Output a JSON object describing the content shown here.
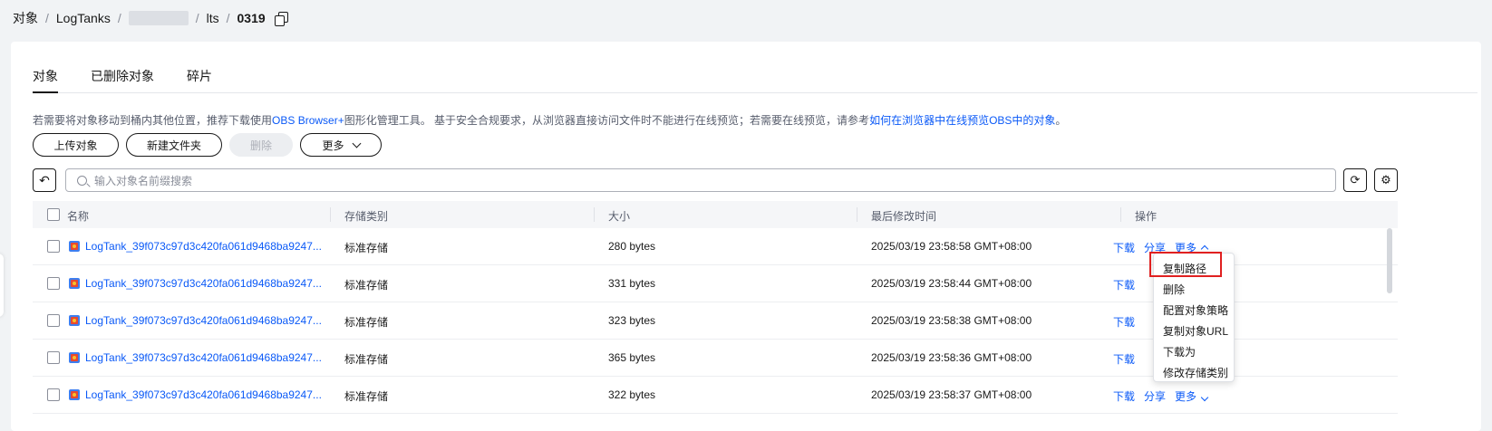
{
  "breadcrumb": {
    "root": "对象",
    "logtanks": "LogTanks",
    "lts": "lts",
    "current": "0319"
  },
  "tabs": [
    "对象",
    "已删除对象",
    "碎片"
  ],
  "info": {
    "prefix": "若需要将对象移动到桶内其他位置，推荐下载使用",
    "link1": "OBS Browser+",
    "middle": "图形化管理工具。 基于安全合规要求，从浏览器直接访问文件时不能进行在线预览；若需要在线预览，请参考",
    "link2": "如何在浏览器中在线预览OBS中的对象",
    "suffix": "。"
  },
  "toolbar": {
    "upload": "上传对象",
    "new_folder": "新建文件夹",
    "delete": "删除",
    "more": "更多"
  },
  "search": {
    "placeholder": "输入对象名前缀搜索"
  },
  "table": {
    "headers": {
      "name": "名称",
      "storage": "存储类别",
      "size": "大小",
      "modified": "最后修改时间",
      "actions": "操作"
    },
    "rows": [
      {
        "name": "LogTank_39f073c97d3c420fa061d9468ba9247...",
        "storage": "标准存储",
        "size": "280 bytes",
        "modified": "2025/03/19 23:58:58 GMT+08:00"
      },
      {
        "name": "LogTank_39f073c97d3c420fa061d9468ba9247...",
        "storage": "标准存储",
        "size": "331 bytes",
        "modified": "2025/03/19 23:58:44 GMT+08:00"
      },
      {
        "name": "LogTank_39f073c97d3c420fa061d9468ba9247...",
        "storage": "标准存储",
        "size": "323 bytes",
        "modified": "2025/03/19 23:58:38 GMT+08:00"
      },
      {
        "name": "LogTank_39f073c97d3c420fa061d9468ba9247...",
        "storage": "标准存储",
        "size": "365 bytes",
        "modified": "2025/03/19 23:58:36 GMT+08:00"
      },
      {
        "name": "LogTank_39f073c97d3c420fa061d9468ba9247...",
        "storage": "标准存储",
        "size": "322 bytes",
        "modified": "2025/03/19 23:58:37 GMT+08:00"
      }
    ],
    "actions": {
      "download": "下载",
      "share": "分享",
      "more": "更多"
    }
  },
  "dropdown_menu": [
    "复制路径",
    "删除",
    "配置对象策略",
    "复制对象URL",
    "下载为",
    "修改存储类别"
  ],
  "colors": {
    "link": "#0a59f7",
    "highlight": "#e02020"
  }
}
